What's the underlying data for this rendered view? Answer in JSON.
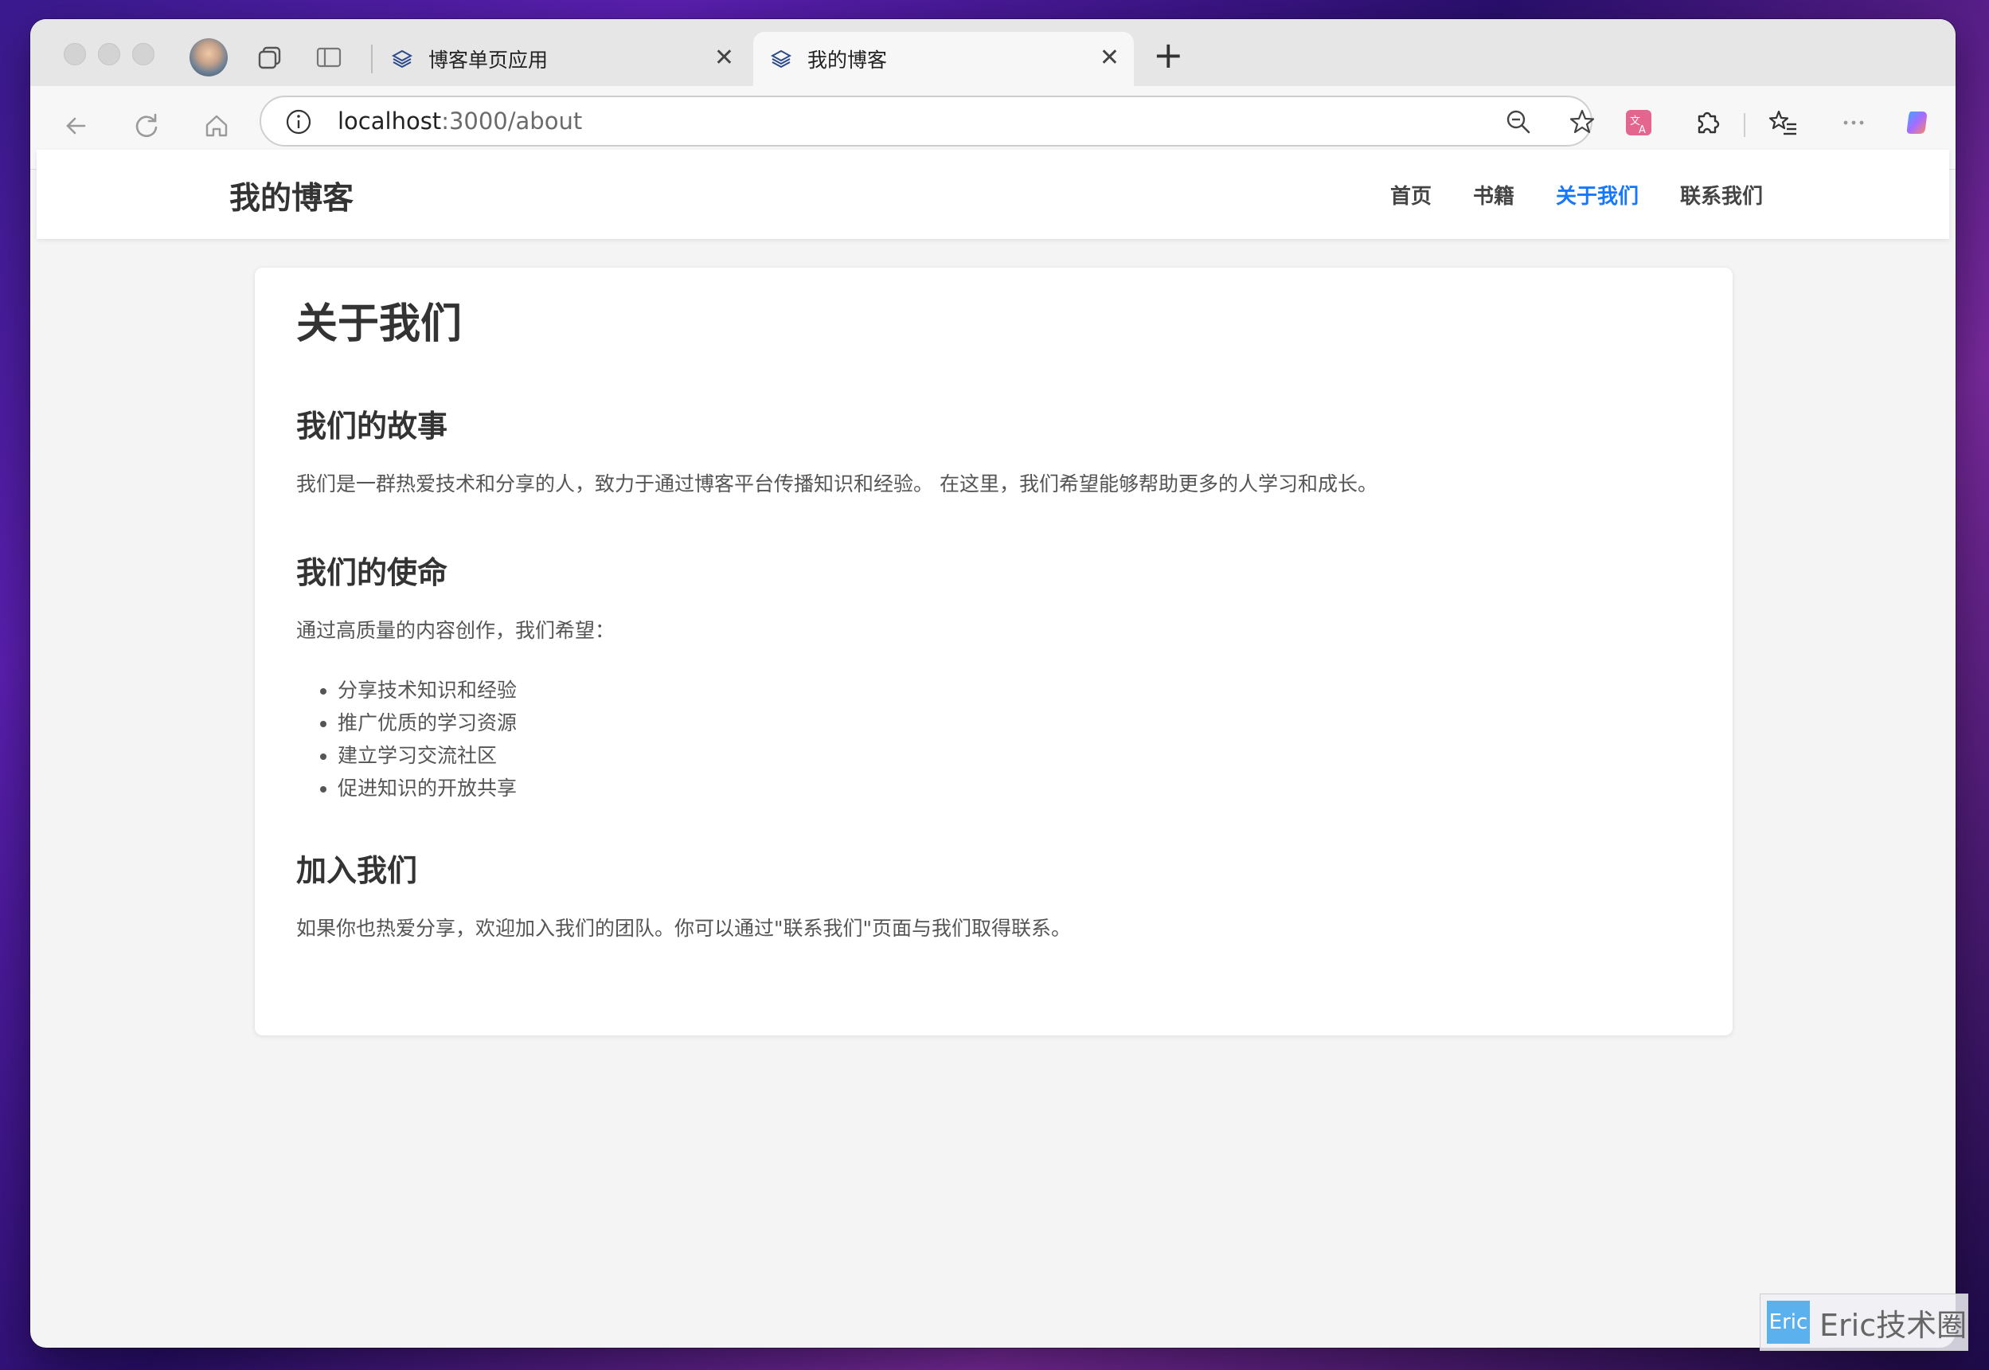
{
  "browser": {
    "tabs": [
      {
        "title": "博客单页应用",
        "active": false
      },
      {
        "title": "我的博客",
        "active": true
      }
    ],
    "url_host": "localhost",
    "url_path": ":3000/about"
  },
  "site": {
    "logo": "我的博客",
    "nav": [
      {
        "label": "首页",
        "active": false
      },
      {
        "label": "书籍",
        "active": false
      },
      {
        "label": "关于我们",
        "active": true
      },
      {
        "label": "联系我们",
        "active": false
      }
    ]
  },
  "content": {
    "title": "关于我们",
    "story_heading": "我们的故事",
    "story_text": "我们是一群热爱技术和分享的人，致力于通过博客平台传播知识和经验。 在这里，我们希望能够帮助更多的人学习和成长。",
    "mission_heading": "我们的使命",
    "mission_intro": "通过高质量的内容创作，我们希望：",
    "mission_items": [
      "分享技术知识和经验",
      "推广优质的学习资源",
      "建立学习交流社区",
      "促进知识的开放共享"
    ],
    "join_heading": "加入我们",
    "join_text": "如果你也热爱分享，欢迎加入我们的团队。你可以通过\"联系我们\"页面与我们取得联系。"
  },
  "watermark": {
    "badge": "Eric",
    "text": "Eric技术圈"
  },
  "colors": {
    "accent": "#1677ff"
  }
}
